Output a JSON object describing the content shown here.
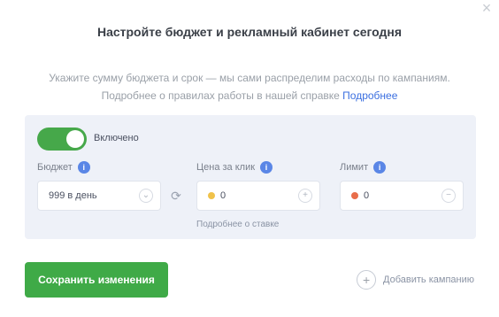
{
  "dialog": {
    "close_glyph": "×",
    "title": "Настройте бюджет и рекламный кабинет сегодня",
    "description": "Укажите сумму бюджета и срок — мы сами распределим расходы по кампаниям. Подробнее о правилах работы в нашей справке",
    "description_link": "Подробнее"
  },
  "panel": {
    "toggle_label": "Включено",
    "field1": {
      "label": "Бюджет",
      "value": "999 в день",
      "suffix": "⌄"
    },
    "field2": {
      "label": "Цена за клик",
      "value": "0",
      "suffix": "+"
    },
    "field3": {
      "label": "Лимит",
      "value": "0",
      "suffix": "−"
    },
    "hint": "Подробнее о ставке",
    "colors": {
      "dot1": "#f0c24a",
      "dot2": "#e86d4a"
    }
  },
  "actions": {
    "primary_label": "Сохранить изменения",
    "secondary_label": "Добавить кампанию",
    "secondary_icon": "+"
  }
}
